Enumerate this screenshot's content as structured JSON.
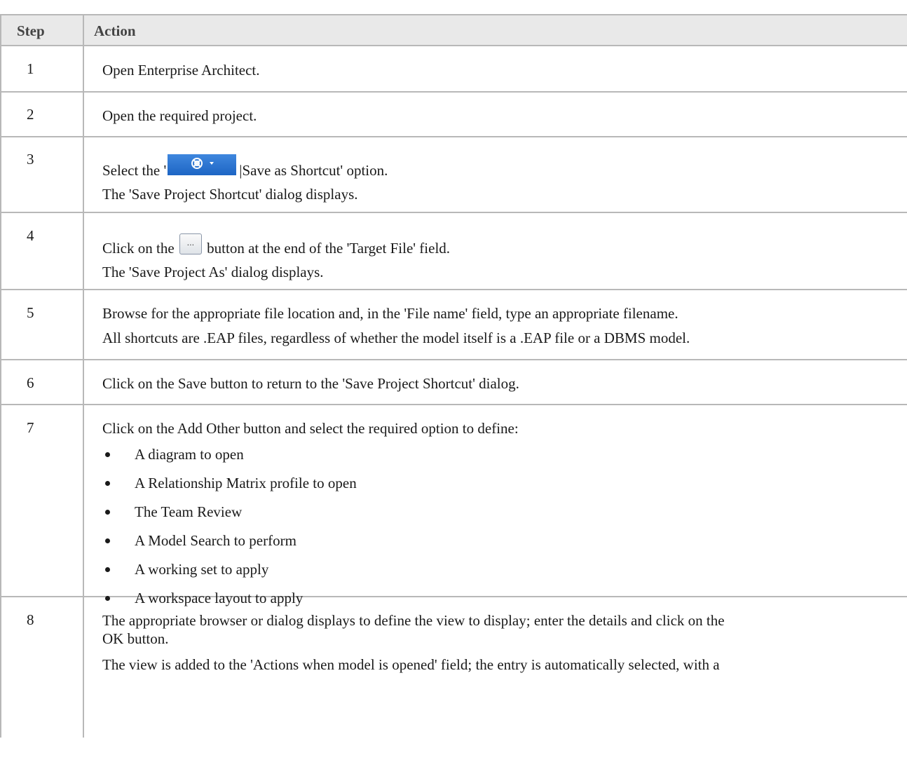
{
  "header": {
    "step": "Step",
    "action": "Action"
  },
  "steps": [
    {
      "num": "1",
      "lines": [
        "Open Enterprise Architect."
      ]
    },
    {
      "num": "2",
      "lines": [
        "Open the required project."
      ]
    },
    {
      "num": "3",
      "line1_prefix": "Select the '",
      "line1_suffix": "|Save as Shortcut' option.",
      "line2": "The 'Save Project Shortcut' dialog displays.",
      "icon": "app-menu-button-icon"
    },
    {
      "num": "4",
      "line1_prefix": "Click on the",
      "line1_suffix": "button at the end of the 'Target File' field.",
      "line2": "The 'Save Project As' dialog displays.",
      "icon": "browse-ellipsis-button-icon",
      "button_glyph": "..."
    },
    {
      "num": "5",
      "lines": [
        "Browse for the appropriate file location and, in the 'File name' field, type an appropriate filename.",
        "All shortcuts are .EAP files, regardless of whether the model itself is a .EAP file or a DBMS model."
      ]
    },
    {
      "num": "6",
      "lines": [
        "Click on the Save button to return to the 'Save Project Shortcut' dialog."
      ]
    },
    {
      "num": "7",
      "intro": "Click on the Add Other button and select the required option to define:",
      "bullets": [
        "A diagram to open",
        "A Relationship Matrix profile to open",
        "The Team Review",
        "A Model Search to perform",
        "A working set to apply",
        "A workspace layout to apply"
      ]
    },
    {
      "num": "8",
      "lines": [
        "The appropriate browser or dialog displays to define the view to display; enter the details and click on the",
        "OK button.",
        "The view is added to the 'Actions when model is opened' field; the entry is automatically selected, with a"
      ]
    }
  ]
}
